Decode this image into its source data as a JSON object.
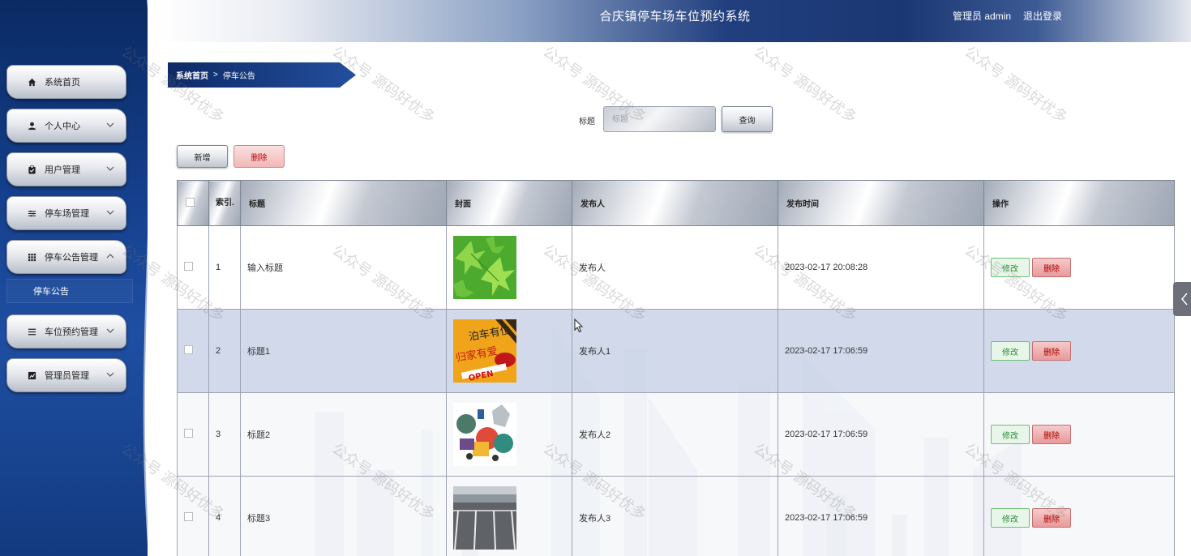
{
  "app": {
    "title": "合庆镇停车场车位预约系统",
    "user_text": "管理员 admin",
    "logout_label": "退出登录"
  },
  "sidebar": {
    "items": [
      {
        "label": "系统首页",
        "icon": "home-icon"
      },
      {
        "label": "个人中心",
        "icon": "user-icon"
      },
      {
        "label": "用户管理",
        "icon": "clipboard-icon"
      },
      {
        "label": "停车场管理",
        "icon": "sliders-icon"
      },
      {
        "label": "停车公告管理",
        "icon": "grid-icon"
      },
      {
        "label": "车位预约管理",
        "icon": "list-icon"
      },
      {
        "label": "管理员管理",
        "icon": "chart-icon"
      }
    ],
    "sub_item": "停车公告"
  },
  "breadcrumb": {
    "home": "系统首页",
    "separator": ">",
    "current": "停车公告"
  },
  "search": {
    "label": "标题",
    "placeholder": "标题",
    "button": "查询"
  },
  "actions": {
    "add": "新增",
    "delete": "删除"
  },
  "table": {
    "headers": {
      "index": "索引.",
      "title": "标题",
      "cover": "封面",
      "publisher": "发布人",
      "time": "发布时间",
      "ops": "操作"
    },
    "rows": [
      {
        "index": "1",
        "title": "输入标题",
        "publisher": "发布人",
        "time": "2023-02-17 20:08:28"
      },
      {
        "index": "2",
        "title": "标题1",
        "publisher": "发布人1",
        "time": "2023-02-17 17:06:59",
        "cover_sign_top": "泊车有位",
        "cover_sign_bottom": "归家有爱",
        "cover_sign_open": "OPEN"
      },
      {
        "index": "3",
        "title": "标题2",
        "publisher": "发布人2",
        "time": "2023-02-17 17:06:59"
      },
      {
        "index": "4",
        "title": "标题3",
        "publisher": "发布人3",
        "time": "2023-02-17 17:06:59"
      }
    ],
    "edit_label": "修改",
    "remove_label": "删除"
  },
  "watermark": "公众号 源码好优多",
  "colors": {
    "sidebar": "#153f8c",
    "header": "#1b3773",
    "selected_row": "#cdd6e8"
  }
}
